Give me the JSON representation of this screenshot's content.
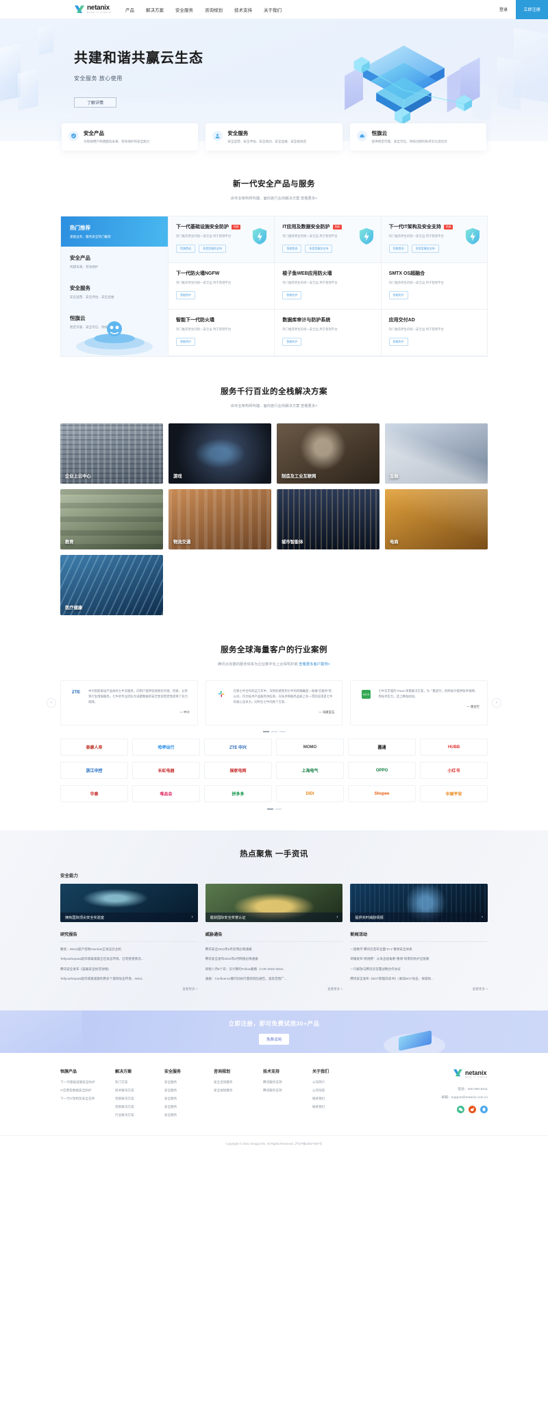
{
  "header": {
    "logo_name": "netanix",
    "logo_tagline": "MAKE IT SIMPLE",
    "nav": [
      {
        "label": "产品"
      },
      {
        "label": "解决方案"
      },
      {
        "label": "安全服务"
      },
      {
        "label": "咨询规划"
      },
      {
        "label": "技术支持"
      },
      {
        "label": "关于我们"
      }
    ],
    "login": "登录",
    "register": "立即注册"
  },
  "hero": {
    "title": "共建和谐共赢云生态",
    "subtitle": "安全服务 放心使用",
    "cta": "了解详情"
  },
  "features": [
    {
      "icon": "shield-icon",
      "title": "安全产品",
      "desc": "为帮助用户构建面向未来、有效保护的安全能力"
    },
    {
      "icon": "user-icon",
      "title": "安全服务",
      "desc": "安全运营、安全评估、安全培训、安全运维、安全规划咨"
    },
    {
      "icon": "cloud-icon",
      "title": "恒旗云",
      "desc": "提供稳定可靠、安全可信、持续创新的私有云与混合云"
    }
  ],
  "products": {
    "title": "新一代安全产品与服务",
    "subtitle": "由专业架构师构建、面向各行业的解决方案",
    "subtitle_link": "查看更多>",
    "sidebar": [
      {
        "title": "热门推荐",
        "desc": "基础业务、服务安全热门推荐",
        "active": true
      },
      {
        "title": "安全产品",
        "desc": "构建未来、有效保护",
        "active": false
      },
      {
        "title": "安全服务",
        "desc": "安全运营、安全评估、安全运维",
        "active": false
      },
      {
        "title": "恒旗云",
        "desc": "稳定可靠、安全可信、持续创新",
        "active": false
      }
    ],
    "cells": [
      {
        "title": "下一代基础设施安全防护",
        "hot": true,
        "hot_label": "热销",
        "desc": "热门推荐原生的统一安全运\n用于管理平台",
        "tags": [
          "恒旗首选",
          "多类型服务支持"
        ],
        "shield": true
      },
      {
        "title": "IT应用及数据安全防护",
        "hot": true,
        "hot_label": "热销",
        "desc": "热门推荐原生的统一安全运\n用于管理平台",
        "tags": [
          "恒旗首选",
          "多类型服务支持"
        ],
        "shield": true
      },
      {
        "title": "下一代IT架构及安全支持",
        "hot": true,
        "hot_label": "热销",
        "desc": "热门推荐原生的统一安全运\n用于管理平台",
        "tags": [
          "恒旗首选",
          "多类型服务支持"
        ],
        "shield": true
      },
      {
        "title": "下一代防火墙NGFW",
        "hot": false,
        "hot_label": "",
        "desc": "热门推荐原生的统一安全运\n用于管理平台",
        "tags": [
          "智能防护"
        ],
        "shield": false
      },
      {
        "title": "梭子鱼WEB应用防火墙",
        "hot": false,
        "hot_label": "",
        "desc": "热门推荐原生的统一安全运\n用于管理平台",
        "tags": [
          "智能防护"
        ],
        "shield": false
      },
      {
        "title": "SMTX OS超融合",
        "hot": false,
        "hot_label": "",
        "desc": "热门推荐原生的统一安全运\n用于管理平台",
        "tags": [
          "智能防护"
        ],
        "shield": false
      },
      {
        "title": "智能下一代防火墙",
        "hot": false,
        "hot_label": "",
        "desc": "热门推荐原生的统一安全运\n用于管理平台",
        "tags": [
          "智能防护"
        ],
        "shield": false
      },
      {
        "title": "数据库审计与防护系统",
        "hot": false,
        "hot_label": "",
        "desc": "热门推荐原生的统一安全运\n用于管理平台",
        "tags": [
          "智能防护"
        ],
        "shield": false
      },
      {
        "title": "应用交付AD",
        "hot": false,
        "hot_label": "",
        "desc": "热门推荐原生的统一安全运\n用于管理平台",
        "tags": [
          "智能防护"
        ],
        "shield": false
      }
    ]
  },
  "solutions": {
    "title": "服务千行百业的全栈解决方案",
    "subtitle": "由专业架构师构建、面向各行业的解决方案",
    "subtitle_link": "查看更多>",
    "items": [
      {
        "label": "企业上云中心",
        "theme": "office-buildings"
      },
      {
        "label": "游戏",
        "theme": "game-controller"
      },
      {
        "label": "制造及工业互联网",
        "theme": "industrial-robot"
      },
      {
        "label": "金融",
        "theme": "laptop-finance"
      },
      {
        "label": "教育",
        "theme": "classroom"
      },
      {
        "label": "物流交通",
        "theme": "shipping-containers"
      },
      {
        "label": "城市智能体",
        "theme": "city-night"
      },
      {
        "label": "电商",
        "theme": "keyboard-hands"
      },
      {
        "label": "医疗健康",
        "theme": "dna-helix"
      }
    ]
  },
  "cases": {
    "title": "服务全球海量客户的行业案例",
    "subtitle": "腾讯云完善的服务体系为企业数字化上云保驾护航",
    "subtitle_link": "查看更多客户案例>",
    "items": [
      {
        "logo": "ZTE",
        "logo_color": "#1a5fb4",
        "quote": "中兴智能家居产品依托七牛云服务，向用户提供音视频云存储、检索、分享等行生增值服务。七牛的专业团队为海量数据的安全性及稳定性提供了有力保障。",
        "author": "一 中兴"
      },
      {
        "logo": "SLACK",
        "logo_color": "#3aaf85",
        "quote": "在和七牛合作的这几年中，深刻的感受到七牛的的确确是一家做\"云服务\"的公司，作为技术产品服务供应商，在技术和服务品质上有一贯的追求是七牛的核心竞争力，同时在七牛的各个方案...",
        "author": "一 海康萤石"
      },
      {
        "logo": "MOJI",
        "logo_color": "#35a853",
        "quote": "七牛云丰富的 PaaS 场景解决方案，为「墨迹空」的跨省计提供技术保障，用技术实力，还上精准助攻。",
        "author": "一 墨迹空"
      }
    ],
    "logo_rows": [
      [
        {
          "name": "泰康人寿",
          "color": "#c0392b"
        },
        {
          "name": "哈啰出行",
          "color": "#1e88e5"
        },
        {
          "name": "ZTE 中兴",
          "color": "#1a5fb4"
        },
        {
          "name": "MOMO",
          "color": "#444"
        },
        {
          "name": "圆通",
          "color": "#111"
        },
        {
          "name": "HUBB",
          "color": "#e03131"
        }
      ],
      [
        {
          "name": "浙江中控",
          "color": "#1565c0"
        },
        {
          "name": "长虹电器",
          "color": "#c62828"
        },
        {
          "name": "国家电网",
          "color": "#c62828"
        },
        {
          "name": "上海电气",
          "color": "#0b7a3d"
        },
        {
          "name": "OPPO",
          "color": "#0b7a3d"
        },
        {
          "name": "小红书",
          "color": "#e03131"
        }
      ],
      [
        {
          "name": "华泰",
          "color": "#c62828"
        },
        {
          "name": "唯品会",
          "color": "#e0245e"
        },
        {
          "name": "拼多多",
          "color": "#0b9444"
        },
        {
          "name": "DIDI",
          "color": "#e8871a"
        },
        {
          "name": "Shopee",
          "color": "#e8590c"
        },
        {
          "name": "中国平安",
          "color": "#e8871a"
        }
      ]
    ]
  },
  "news": {
    "title": "热点聚焦 一手资讯",
    "sub_heading": "安全能力",
    "images": [
      {
        "caption": "拥有国际顶尖安全实验室",
        "theme": "lab-cyan"
      },
      {
        "caption": "屡获国际安全奖誉认证",
        "theme": "trophy-gold"
      },
      {
        "caption": "提供实时威胁情报",
        "theme": "eye-blue"
      }
    ],
    "columns": [
      {
        "heading": "研究报告",
        "items": [
          "聚焦：DDoS庭户控制Atombot正攻击云主机",
          "Tellyouthepass敲诈病毒紧跟正在攻击环境、已有受害情况...",
          "腾讯安全发布《容器安全防范攻略》",
          "Tellyouthepass敲诈病毒紧跟利用多个漏洞攻击环境、Wind..."
        ],
        "more": "查看更多 >"
      },
      {
        "heading": "威胁通告",
        "items": [
          "腾讯安全2022年6月双周必情通报",
          "腾讯安全发布2022年5月网络必情通报",
          "喷锐八月8个日：云计算的Follow路路（CVE-2022-3019...",
          "通报：Confluence服代码执行漏洞风险通告，波及范围广..."
        ],
        "more": "查看更多 >"
      },
      {
        "heading": "新闻活动",
        "items": [
          "一窗数字 腾讯云宣布全面\"3+1\"重保安全体系",
          "荣耀发布\"新视野：从攻击视角看\"重保\"场景的防护全链路",
          "一汽解放与腾讯云签署战略合作协议",
          "腾讯安全发布《BOT管理白皮书》| 解读BOT攻击、探索防..."
        ],
        "more": "查看更多 >"
      }
    ]
  },
  "cta": {
    "title": "立即注册，即可免费试用30+产品",
    "button": "免费试用"
  },
  "footer": {
    "columns": [
      {
        "heading": "恒旗产品",
        "links": [
          "下一代基础设施安全防护",
          "IT应用及数据安全防护",
          "下一代IT架构及安全支持"
        ]
      },
      {
        "heading": "解决方案",
        "links": [
          "热门方案",
          "技术解决方案",
          "场景解决方案",
          "场景解决方案",
          "行业解决方案"
        ]
      },
      {
        "heading": "安全服务",
        "links": [
          "安全服务",
          "安全服务",
          "安全服务",
          "安全服务",
          "安全服务"
        ]
      },
      {
        "heading": "咨询规划",
        "links": [
          "安全咨询服务",
          "安全规划服务"
        ]
      },
      {
        "heading": "技术支持",
        "links": [
          "腾讯服务支持",
          "腾讯服务支持"
        ]
      },
      {
        "heading": "关于我们",
        "links": [
          "公司简介",
          "公司动态",
          "联系我们",
          "联系我们"
        ]
      }
    ],
    "logo_name": "netanix",
    "logo_tagline": "MAKE IT SIMPLE",
    "contact": [
      "电话：400-660-6311",
      "邮箱：support@netanix.com.cn"
    ],
    "socials": [
      "wechat-icon",
      "weibo-icon",
      "qq-icon"
    ],
    "copyright": "Copyright © 2021 Xengqi Info. All Rights Reserved. 沪ICP备18027687号"
  }
}
